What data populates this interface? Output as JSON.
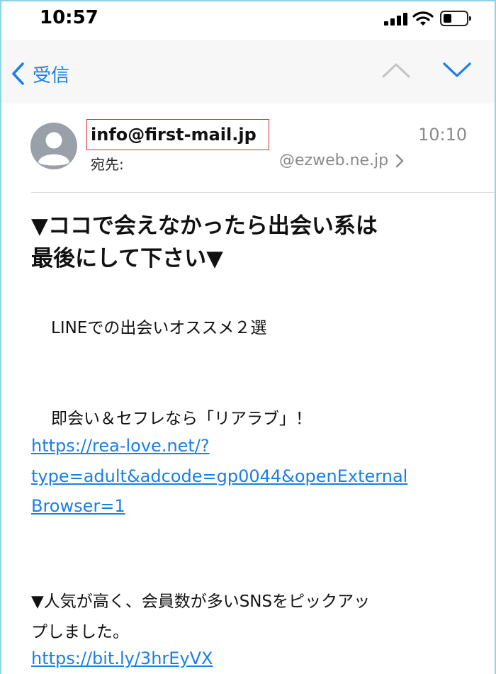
{
  "status_bar": {
    "time": "10:57"
  },
  "nav": {
    "back_label": "受信"
  },
  "header": {
    "sender": "info@first-mail.jp",
    "time": "10:10",
    "to_label": "宛先:",
    "to_address": "@ezweb.ne.jp"
  },
  "email": {
    "subject_line1": "▼ココで会えなかったら出会い系は",
    "subject_line2": "最後にして下さい▼",
    "intro": "LINEでの出会いオススメ２選",
    "item1_text": "即会い＆セフレなら「リアラブ」！",
    "item1_link_line1": "https://rea-love.net/?",
    "item1_link_line2": "type=adult&adcode=gp0044&openExternal",
    "item1_link_line3": "Browser=1",
    "item2_text_line1": "▼人気が高く、会員数が多いSNSをピックアッ",
    "item2_text_line2": "プしました。",
    "item2_link": "https://bit.ly/3hrEyVX"
  },
  "colors": {
    "accent": "#1a7fe6",
    "highlight_box": "#e0283c",
    "secondary_text": "#8a8a8e"
  },
  "icons": [
    "back-chevron-icon",
    "chevron-up-icon",
    "chevron-down-icon",
    "avatar-icon",
    "chevron-right-icon",
    "cellular-signal-icon",
    "wifi-icon",
    "battery-icon"
  ]
}
